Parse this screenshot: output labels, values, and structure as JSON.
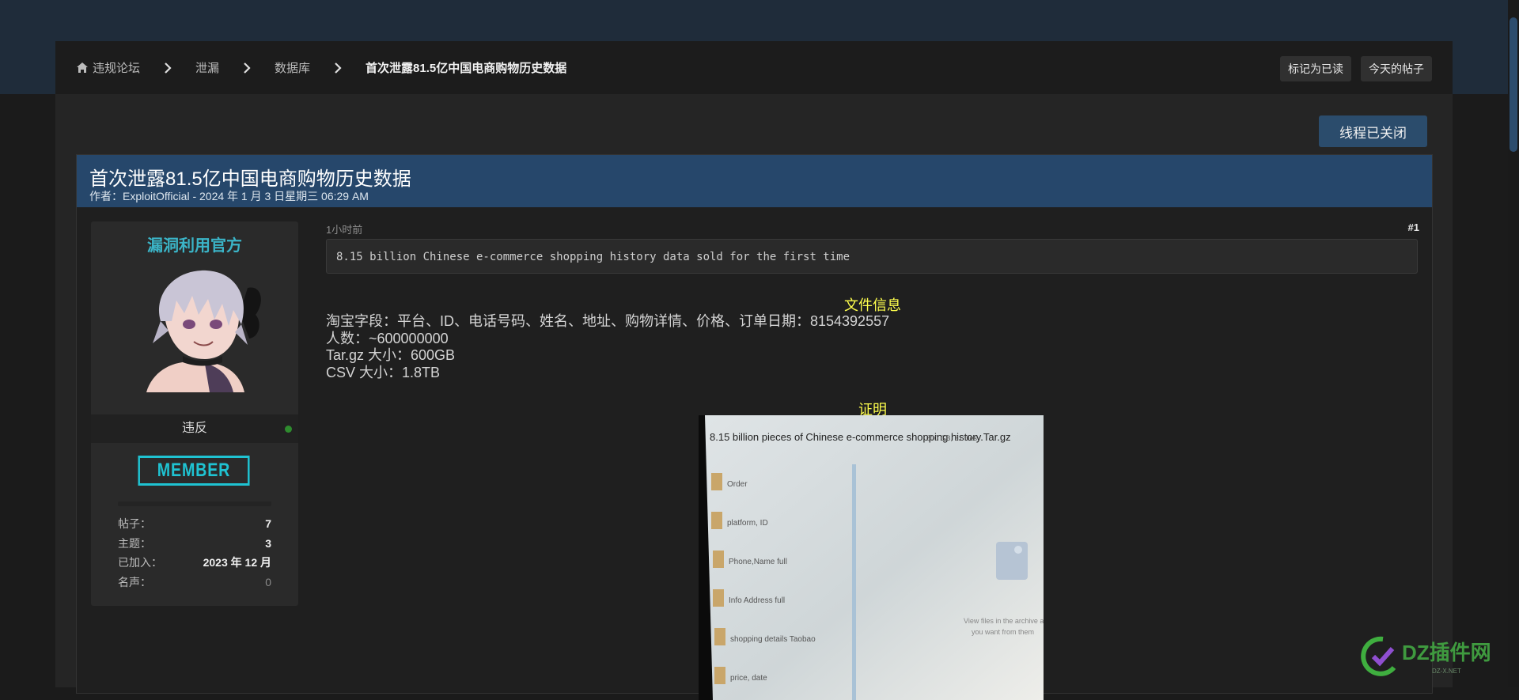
{
  "breadcrumb": {
    "items": [
      "违规论坛",
      "泄漏",
      "数据库"
    ],
    "current": "首次泄露81.5亿中国电商购物历史数据"
  },
  "toolbar": {
    "mark_read": "标记为已读",
    "todays_posts": "今天的帖子",
    "thread_closed": "线程已关闭"
  },
  "thread": {
    "title": "首次泄露81.5亿中国电商购物历史数据",
    "meta": "作者：ExploitOfficial - 2024 年 1 月 3 日星期三 06:29 AM"
  },
  "user": {
    "name": "漏洞利用官方",
    "status": "违反",
    "rank": "MEMBER",
    "stats": [
      {
        "label": "帖子：",
        "value": "7"
      },
      {
        "label": "主题：",
        "value": "3"
      },
      {
        "label": "已加入：",
        "value": "2023 年 12 月"
      },
      {
        "label": "名声：",
        "value": "0"
      }
    ]
  },
  "post": {
    "time": "1小时前",
    "number": "#1",
    "code": "8.15 billion Chinese e-commerce shopping history data sold for the first time",
    "file_info_title": "文件信息",
    "file_info_lines": [
      "淘宝字段：平台、ID、电话号码、姓名、地址、购物详情、价格、订单日期：8154392557",
      "人数：~600000000",
      "Tar.gz 大小：600GB",
      "CSV 大小：1.8TB"
    ],
    "proof_title": "证明",
    "proof_image": {
      "header": "8.15 billion pieces of Chinese e-commerce shopping history.Tar.gz",
      "header_meta": "600 GB, 31 files",
      "folders": [
        "Order",
        "platform, ID",
        "Phone,Name full",
        "Info Address full",
        "shopping details Taobao",
        "price, date"
      ],
      "hint_line1": "View files in the archive and extract",
      "hint_line2": "you want from them"
    }
  },
  "watermark": {
    "brand": "DZ插件网",
    "url": "DZ-X.NET"
  },
  "colors": {
    "accent": "#26476b",
    "username": "#3bb4c7",
    "highlight": "#ffff4d",
    "rank": "#1fc3d2"
  }
}
